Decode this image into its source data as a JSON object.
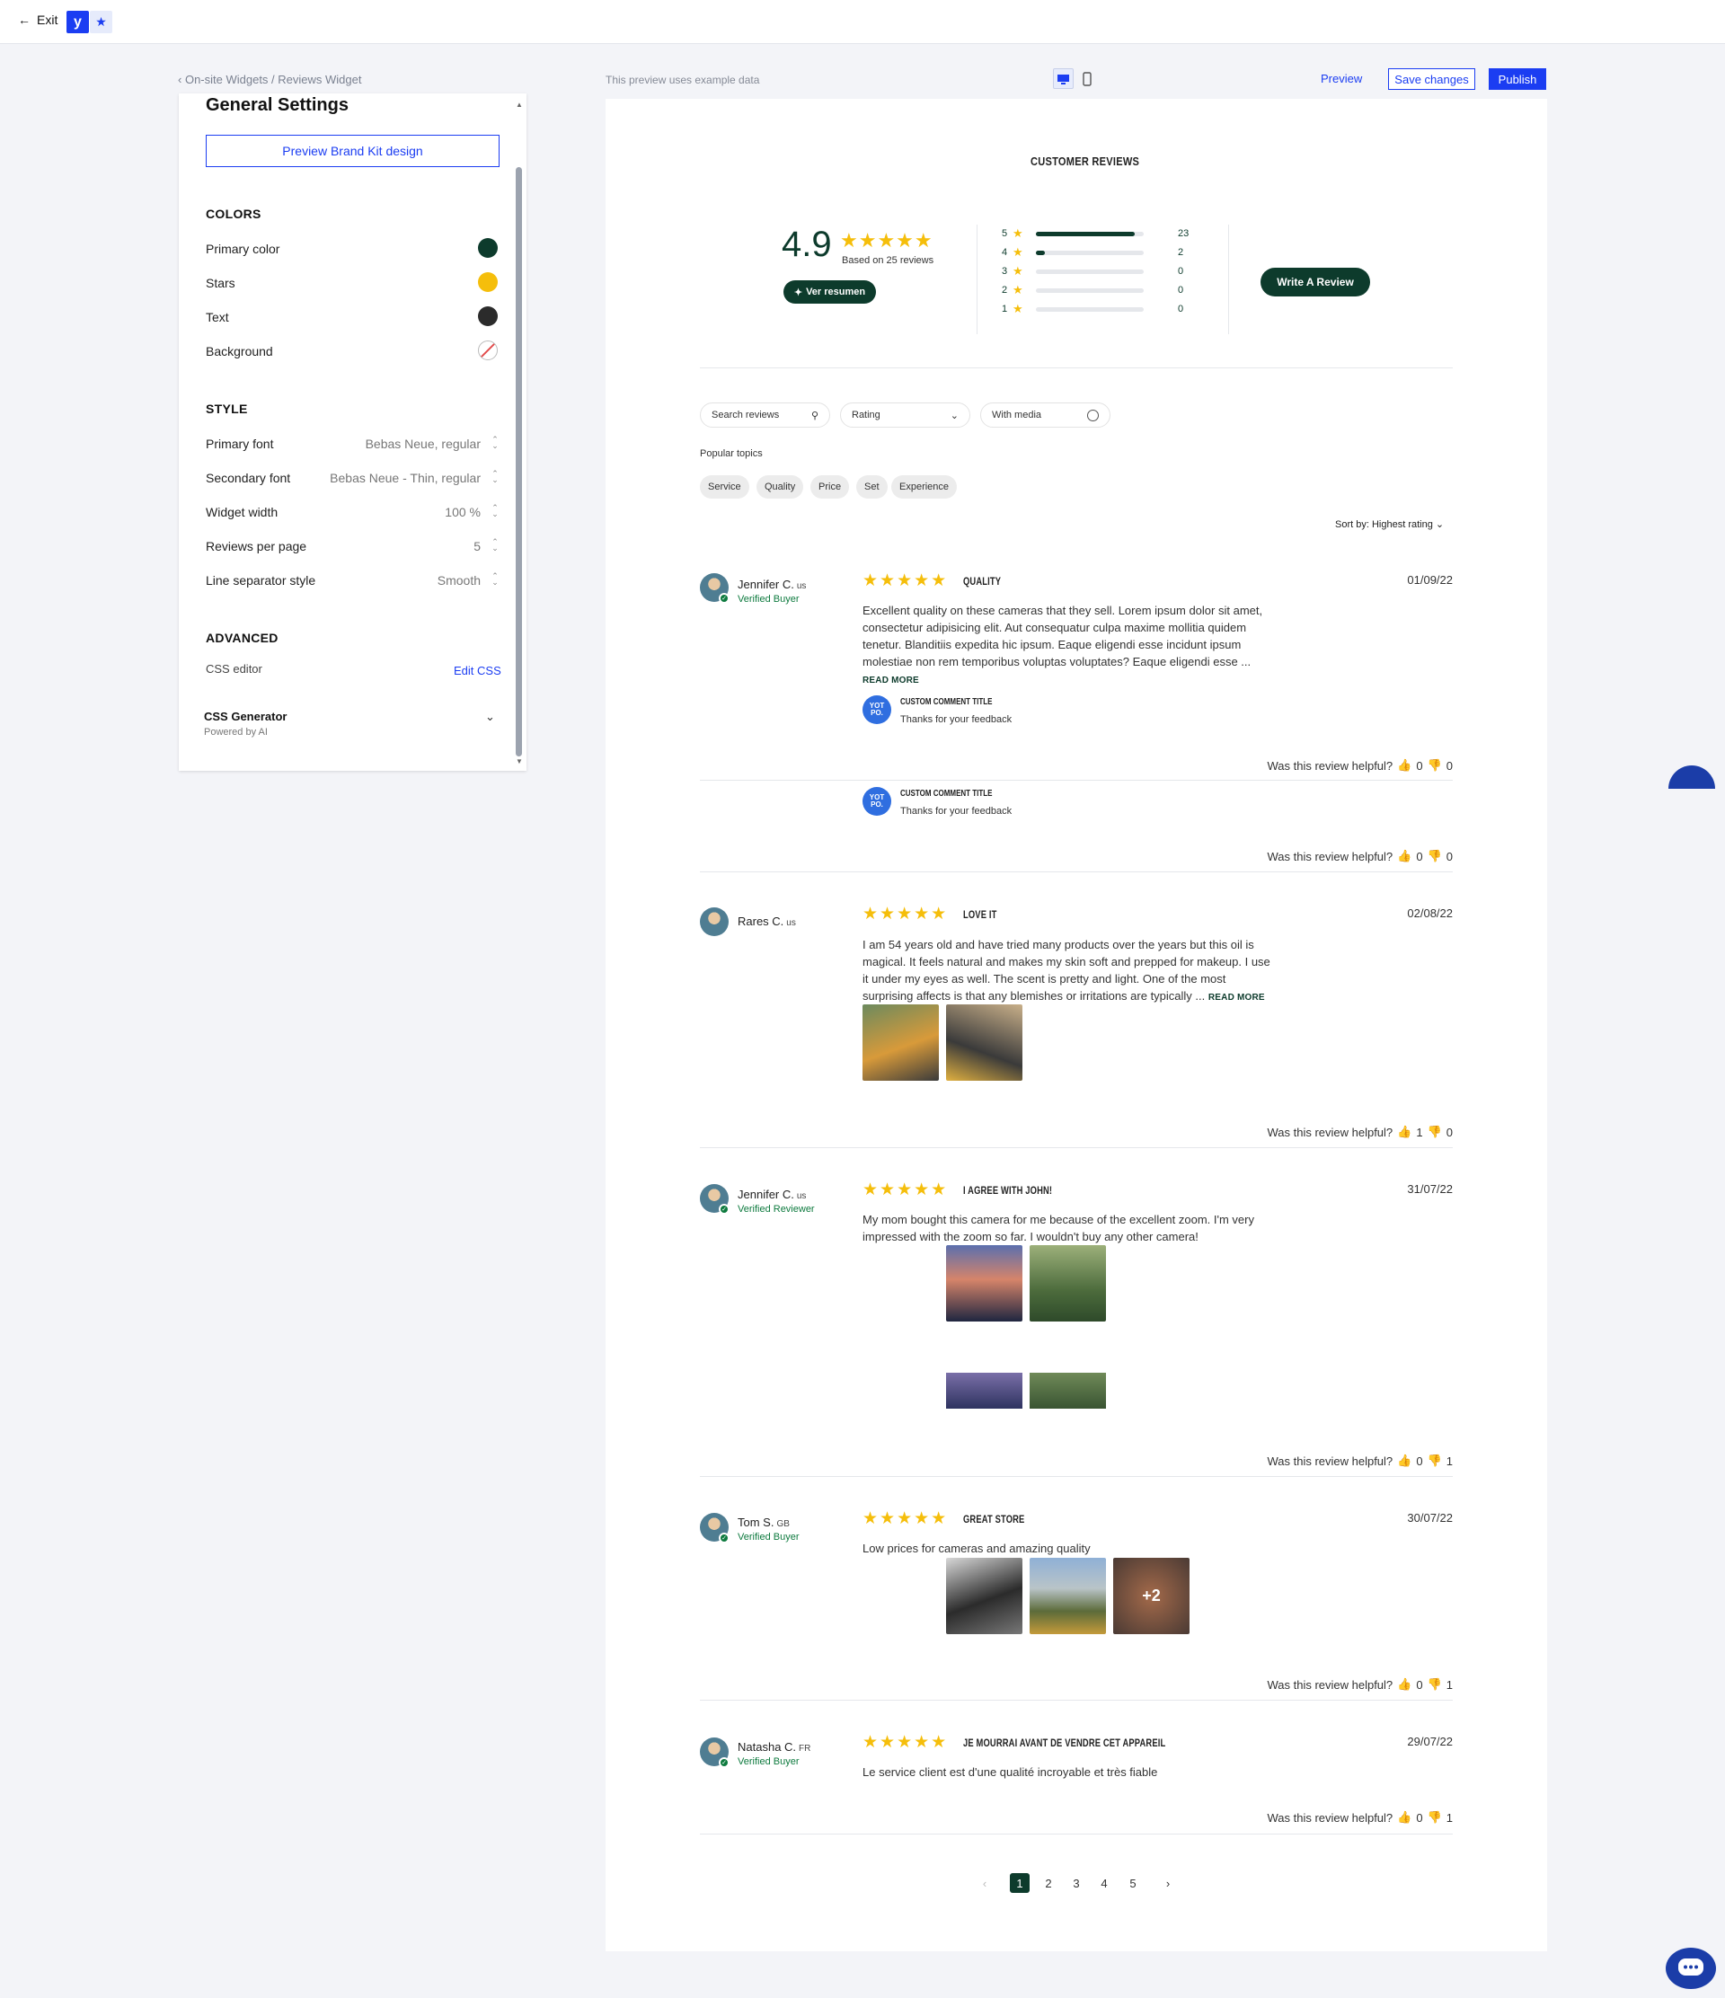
{
  "topbar": {
    "exit_label": "Exit",
    "logo_letter": "y"
  },
  "breadcrumb": "On-site Widgets / Reviews Widget",
  "preview_note": "This preview uses example data",
  "actions": {
    "preview": "Preview",
    "save": "Save changes",
    "publish": "Publish"
  },
  "panel": {
    "title": "General Settings",
    "brand_kit_button": "Preview Brand Kit design",
    "colors_heading": "COLORS",
    "colors": [
      {
        "label": "Primary color",
        "color": "#0d3b2c"
      },
      {
        "label": "Stars",
        "color": "#f5be0b"
      },
      {
        "label": "Text",
        "color": "#2b2b2b"
      },
      {
        "label": "Background",
        "color": "none"
      }
    ],
    "style_heading": "STYLE",
    "style": [
      {
        "label": "Primary font",
        "value": "Bebas Neue, regular"
      },
      {
        "label": "Secondary font",
        "value": "Bebas Neue - Thin, regular"
      },
      {
        "label": "Widget width",
        "value": "100 %"
      },
      {
        "label": "Reviews per page",
        "value": "5"
      },
      {
        "label": "Line separator style",
        "value": "Smooth"
      }
    ],
    "advanced_heading": "ADVANCED",
    "css_editor_label": "CSS editor",
    "edit_css": "Edit CSS",
    "css_generator": "CSS Generator",
    "powered_by": "Powered by AI"
  },
  "widget": {
    "title": "CUSTOMER REVIEWS",
    "average": "4.9",
    "based_on": "Based on 25 reviews",
    "summary_button": "Ver resumen",
    "write_review": "Write A Review",
    "histogram": [
      {
        "stars": "5",
        "count": "23",
        "fraction": 0.92
      },
      {
        "stars": "4",
        "count": "2",
        "fraction": 0.08
      },
      {
        "stars": "3",
        "count": "0",
        "fraction": 0
      },
      {
        "stars": "2",
        "count": "0",
        "fraction": 0
      },
      {
        "stars": "1",
        "count": "0",
        "fraction": 0
      }
    ],
    "search_placeholder": "Search reviews",
    "rating_filter": "Rating",
    "media_filter": "With media",
    "popular_topics_label": "Popular topics",
    "topics": [
      "Service",
      "Quality",
      "Price",
      "Set",
      "Experience"
    ],
    "sort_by": "Sort by: Highest rating",
    "helpful_label": "Was this review helpful?",
    "comment_title": "CUSTOM COMMENT TITLE",
    "comment_text": "Thanks for your feedback",
    "yotpo_badge": "YOT PO.",
    "read_more": "READ MORE",
    "plus_more": "+2",
    "stars_glyphs": "★★★★★",
    "reviews": [
      {
        "name": "Jennifer C.",
        "country": "us",
        "status": "Verified Buyer",
        "title": "QUALITY",
        "date": "01/09/22",
        "body": "Excellent quality on these cameras that they sell. Lorem ipsum dolor sit amet, consectetur adipisicing elit. Aut consequatur culpa maxime mollitia quidem tenetur. Blanditiis expedita hic ipsum. Eaque eligendi esse incidunt ipsum molestiae non rem temporibus voluptas voluptates? Eaque eligendi esse ...",
        "up": "0",
        "down": "0",
        "up2": "0",
        "down2": "0"
      },
      {
        "name": "Rares C.",
        "country": "us",
        "status": "",
        "title": "LOVE IT",
        "date": "02/08/22",
        "body": "I am 54 years old and have tried many products over the years but this oil is magical. It feels natural and makes my skin soft and prepped for makeup. I use it under my eyes as well. The scent is pretty and light. One of the most surprising affects is that any blemishes or irritations are typically ...",
        "up": "1",
        "down": "0"
      },
      {
        "name": "Jennifer C.",
        "country": "us",
        "status": "Verified Reviewer",
        "title": "I AGREE WITH JOHN!",
        "date": "31/07/22",
        "body": "My mom bought this camera for me because of the excellent zoom. I'm very impressed with the zoom so far. I wouldn't buy any other camera!",
        "up": "0",
        "down": "1"
      },
      {
        "name": "Tom S.",
        "country": "GB",
        "status": "Verified Buyer",
        "title": "GREAT STORE",
        "date": "30/07/22",
        "body": "Low prices for cameras and amazing quality",
        "up": "0",
        "down": "1"
      },
      {
        "name": "Natasha C.",
        "country": "FR",
        "status": "Verified Buyer",
        "title": "JE MOURRAI AVANT DE VENDRE CET APPAREIL",
        "date": "29/07/22",
        "body": "Le service client est d'une qualité incroyable et très fiable",
        "up": "0",
        "down": "1"
      }
    ],
    "pagination": [
      "1",
      "2",
      "3",
      "4",
      "5"
    ]
  }
}
